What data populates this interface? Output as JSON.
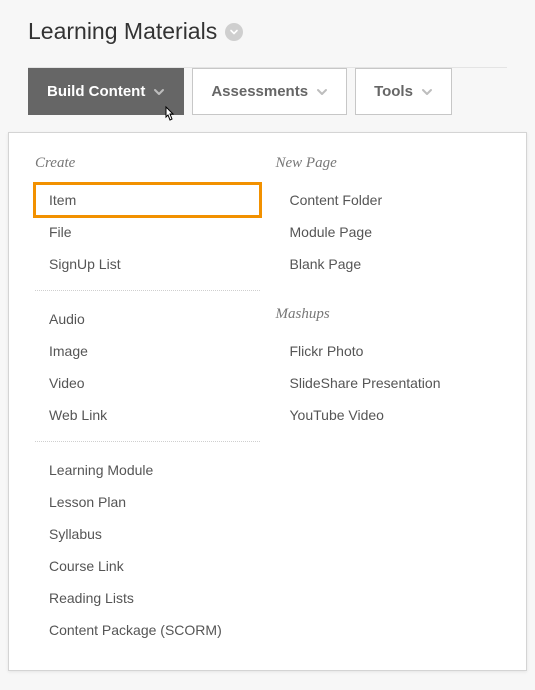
{
  "page": {
    "title": "Learning Materials"
  },
  "toolbar": {
    "build_content": "Build Content",
    "assessments": "Assessments",
    "tools": "Tools"
  },
  "colors": {
    "highlight": "#f29100",
    "active_bg": "#666666"
  },
  "dropdown": {
    "left": {
      "heading": "Create",
      "group1": {
        "item": "Item",
        "file": "File",
        "signup": "SignUp List"
      },
      "group2": {
        "audio": "Audio",
        "image": "Image",
        "video": "Video",
        "web_link": "Web Link"
      },
      "group3": {
        "learning_module": "Learning Module",
        "lesson_plan": "Lesson Plan",
        "syllabus": "Syllabus",
        "course_link": "Course Link",
        "reading_lists": "Reading Lists",
        "scorm": "Content Package (SCORM)"
      }
    },
    "right": {
      "new_page": {
        "heading": "New Page",
        "content_folder": "Content Folder",
        "module_page": "Module Page",
        "blank_page": "Blank Page"
      },
      "mashups": {
        "heading": "Mashups",
        "flickr": "Flickr Photo",
        "slideshare": "SlideShare Presentation",
        "youtube": "YouTube Video"
      }
    }
  }
}
